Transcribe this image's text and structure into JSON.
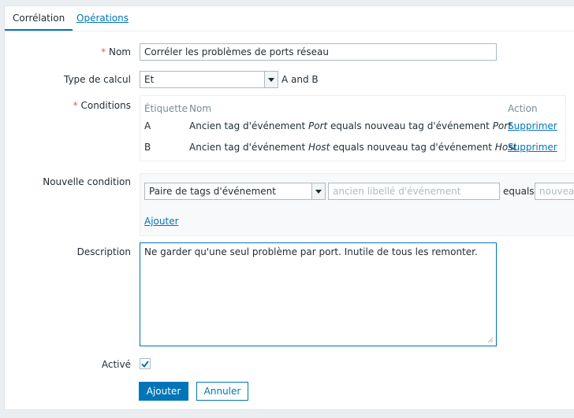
{
  "tabs": [
    {
      "label": "Corrélation",
      "active": true
    },
    {
      "label": "Opérations",
      "active": false
    }
  ],
  "form": {
    "name_label": "Nom",
    "name_value": "Corréler les problèmes de ports réseau",
    "calc_label": "Type de calcul",
    "calc_value": "Et",
    "calc_formula": "A and B",
    "conditions_label": "Conditions",
    "conditions": {
      "headers": [
        "Étiquette",
        "Nom",
        "Action"
      ],
      "rows": [
        {
          "label": "A",
          "text_before": "Ancien tag d'événement ",
          "old_tag": "Port",
          "text_middle": " equals nouveau tag d'événement ",
          "new_tag": "Port",
          "action": "Supprimer"
        },
        {
          "label": "B",
          "text_before": "Ancien tag d'événement ",
          "old_tag": "Host",
          "text_middle": " equals nouveau tag d'événement ",
          "new_tag": "Host",
          "action": "Supprimer"
        }
      ]
    },
    "new_condition_label": "Nouvelle condition",
    "new_condition": {
      "type_value": "Paire de tags d'événement",
      "old_placeholder": "ancien libellé d'événement",
      "operator": "equals",
      "new_placeholder": "nouveau",
      "add_label": "Ajouter"
    },
    "description_label": "Description",
    "description_value": "Ne garder qu'une seul problème par port. Inutile de tous les remonter.",
    "enabled_label": "Activé",
    "enabled": true
  },
  "buttons": {
    "submit": "Ajouter",
    "cancel": "Annuler"
  },
  "colors": {
    "accent": "#0275b8",
    "required": "#e45959",
    "background": "#ebeef0"
  }
}
